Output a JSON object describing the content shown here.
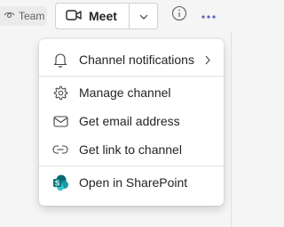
{
  "header": {
    "team_label": "Team",
    "meet_label": "Meet"
  },
  "menu": {
    "items": [
      {
        "label": "Channel notifications",
        "icon": "bell-icon",
        "has_submenu": true
      },
      {
        "label": "Manage channel",
        "icon": "gear-icon"
      },
      {
        "label": "Get email address",
        "icon": "mail-icon"
      },
      {
        "label": "Get link to channel",
        "icon": "link-icon"
      },
      {
        "label": "Open in SharePoint",
        "icon": "sharepoint-icon"
      }
    ]
  },
  "colors": {
    "sharepoint_teal": "#03787c",
    "accent": "#5b5fc7"
  }
}
